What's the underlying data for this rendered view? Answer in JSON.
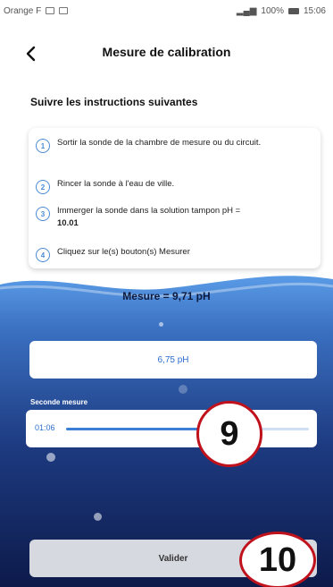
{
  "status_bar": {
    "carrier": "Orange F",
    "right_text": "100%",
    "time": "15:06"
  },
  "header": {
    "title": "Mesure de calibration"
  },
  "instructions": {
    "heading": "Suivre les instructions suivantes",
    "steps": [
      {
        "num": "1",
        "text": "Sortir la sonde de la chambre de mesure ou du circuit."
      },
      {
        "num": "2",
        "text": "Rincer la sonde à l'eau de ville."
      },
      {
        "num": "3",
        "text": "Immerger la sonde dans la solution tampon pH =",
        "bold": "10.01"
      },
      {
        "num": "4",
        "text": "Cliquez sur le(s) bouton(s) Mesurer"
      }
    ]
  },
  "measure": {
    "title": "Mesure = 9,71 pH",
    "value": "6,75 pH",
    "second_label": "Seconde mesure",
    "timer": "01:06",
    "progress": 0.55
  },
  "validate_label": "Valider",
  "annotations": {
    "nine": "9",
    "ten": "10"
  },
  "colors": {
    "accent": "#2e6fd0",
    "annotation": "#c0121c",
    "gradient_top": "#4d8fe0",
    "gradient_bottom": "#0f1f52"
  }
}
